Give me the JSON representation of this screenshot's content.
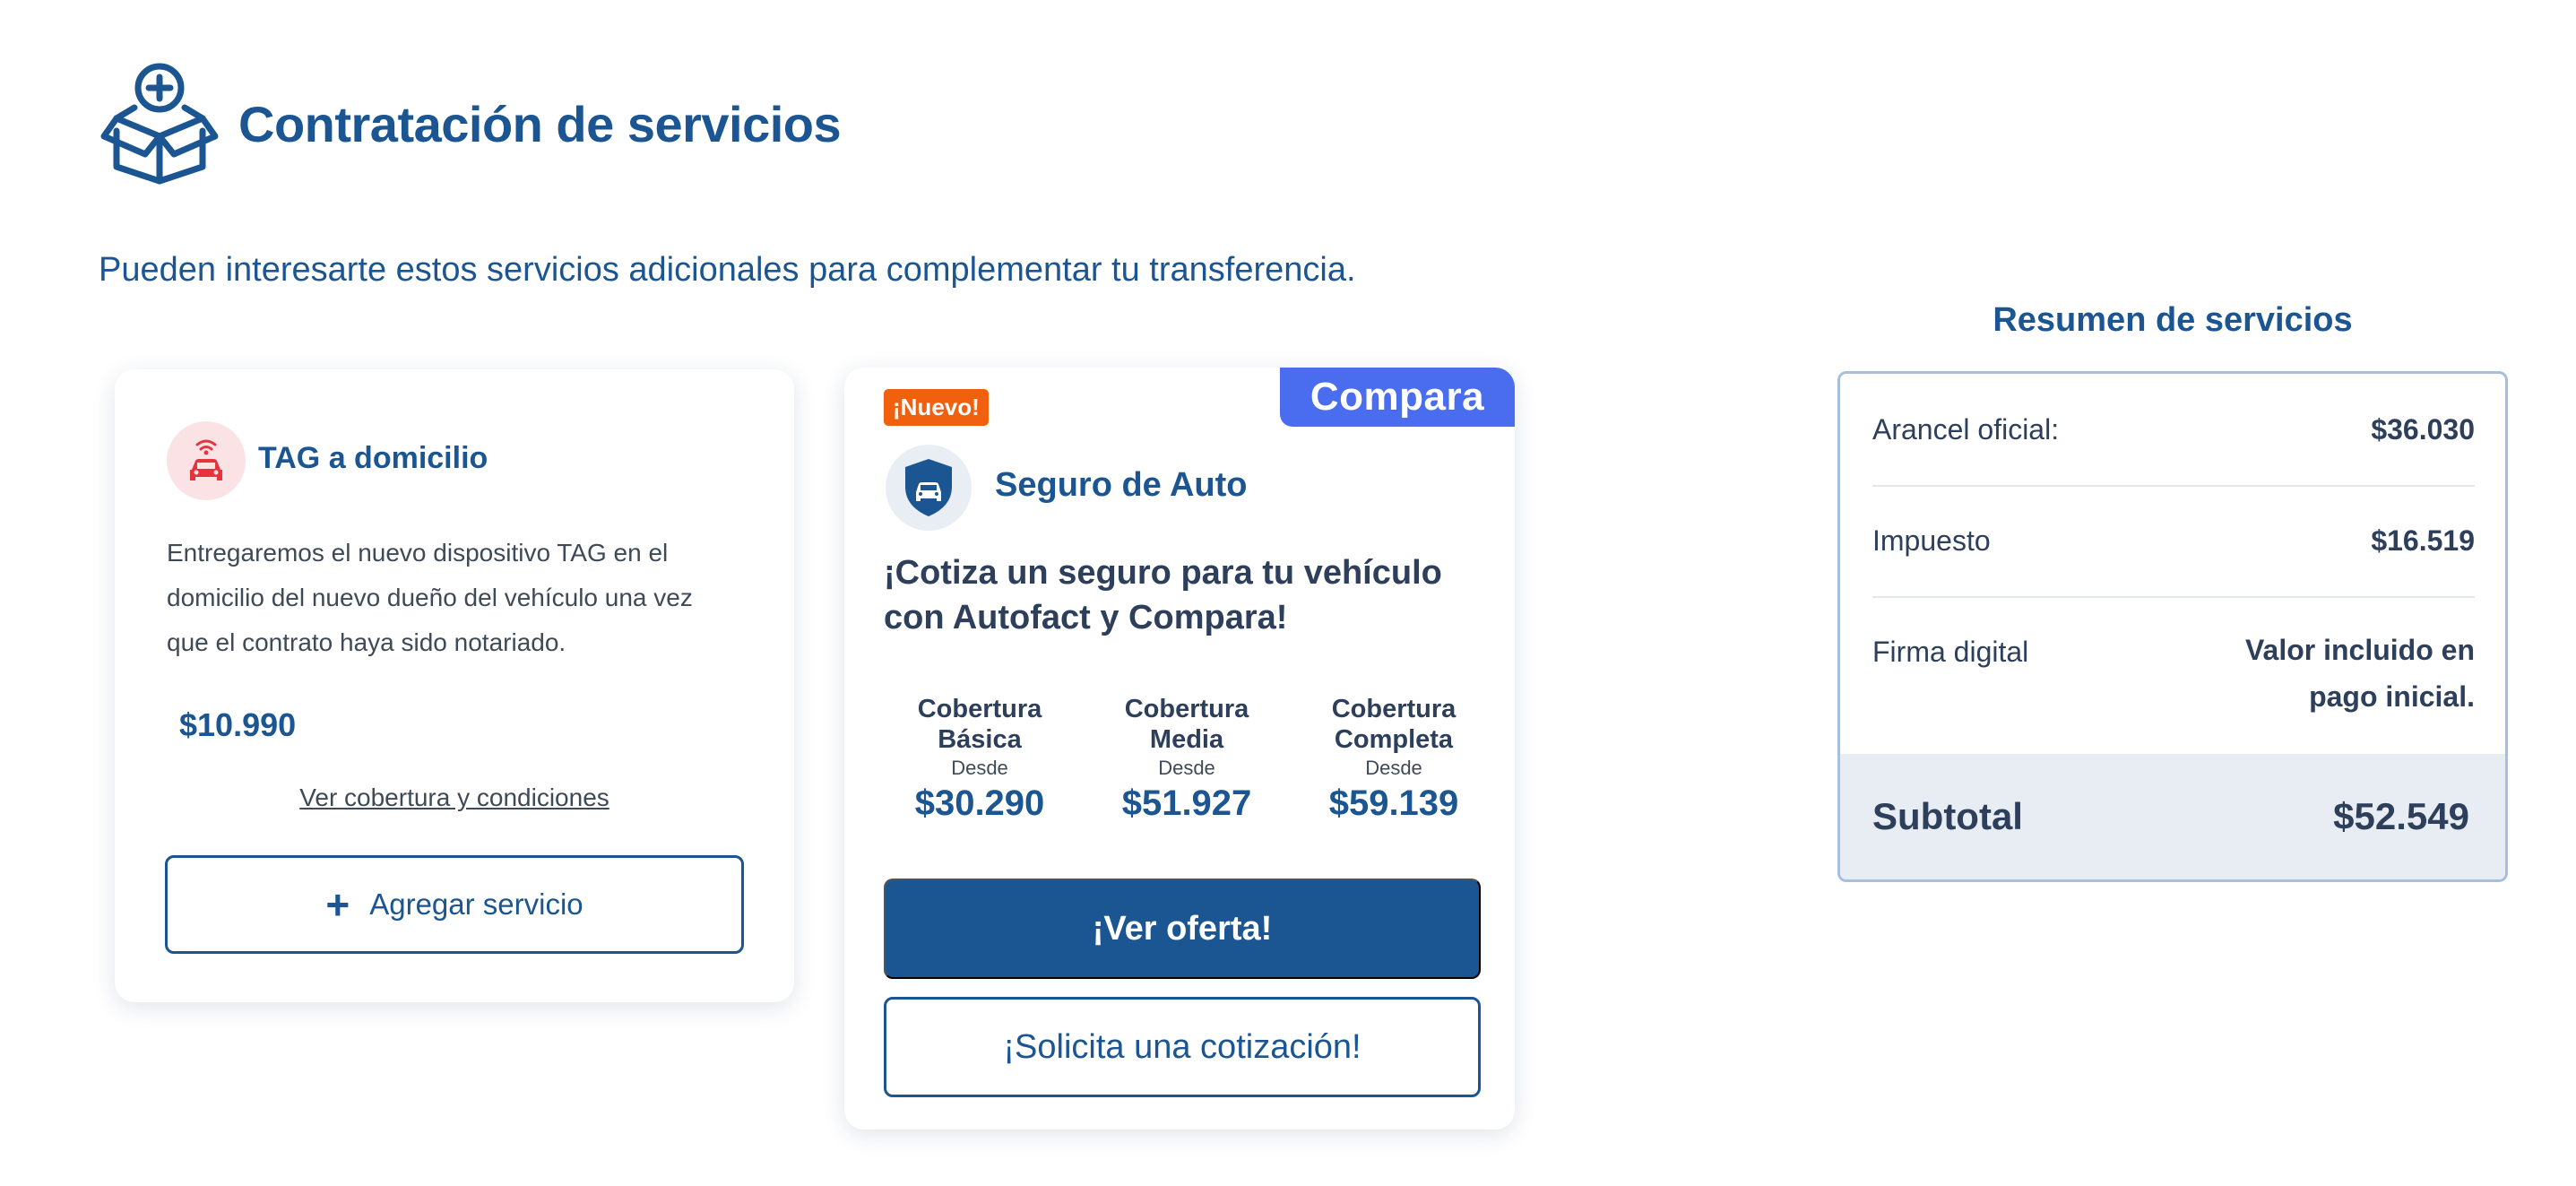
{
  "page": {
    "title": "Contratación de servicios",
    "intro": "Pueden interesarte estos servicios adicionales para complementar tu transferencia.",
    "header_icon": "box-add-icon"
  },
  "tag_service": {
    "icon": "car-signal-icon",
    "title": "TAG a domicilio",
    "description": "Entregaremos el nuevo dispositivo TAG en el domicilio del nuevo dueño del vehículo una vez que el contrato haya sido notariado.",
    "price": "$10.990",
    "link": "Ver cobertura y condiciones",
    "add_button": "Agregar servicio"
  },
  "insurance": {
    "badge": "¡Nuevo!",
    "partner_logo": "Compara",
    "icon": "shield-car-icon",
    "title": "Seguro de Auto",
    "headline": "¡Cotiza un seguro para tu vehículo con Autofact y Compara!",
    "coverages": [
      {
        "name": "Cobertura Básica",
        "from": "Desde",
        "price": "$30.290"
      },
      {
        "name": "Cobertura Media",
        "from": "Desde",
        "price": "$51.927"
      },
      {
        "name": "Cobertura Completa",
        "from": "Desde",
        "price": "$59.139"
      }
    ],
    "offer_button": "¡Ver oferta!",
    "quote_button": "¡Solicita una cotización!"
  },
  "summary": {
    "title": "Resumen de servicios",
    "rows": [
      {
        "label": "Arancel oficial:",
        "value": "$36.030"
      },
      {
        "label": "Impuesto",
        "value": "$16.519"
      },
      {
        "label": "Firma digital",
        "value": "Valor incluido en pago inicial."
      }
    ],
    "subtotal_label": "Subtotal",
    "subtotal_value": "$52.549"
  },
  "colors": {
    "primary": "#1b5592",
    "badge": "#f0600f",
    "compara": "#4a6df0",
    "tag_icon": "#e8333f",
    "subtotal_bg": "#e8edf3"
  }
}
